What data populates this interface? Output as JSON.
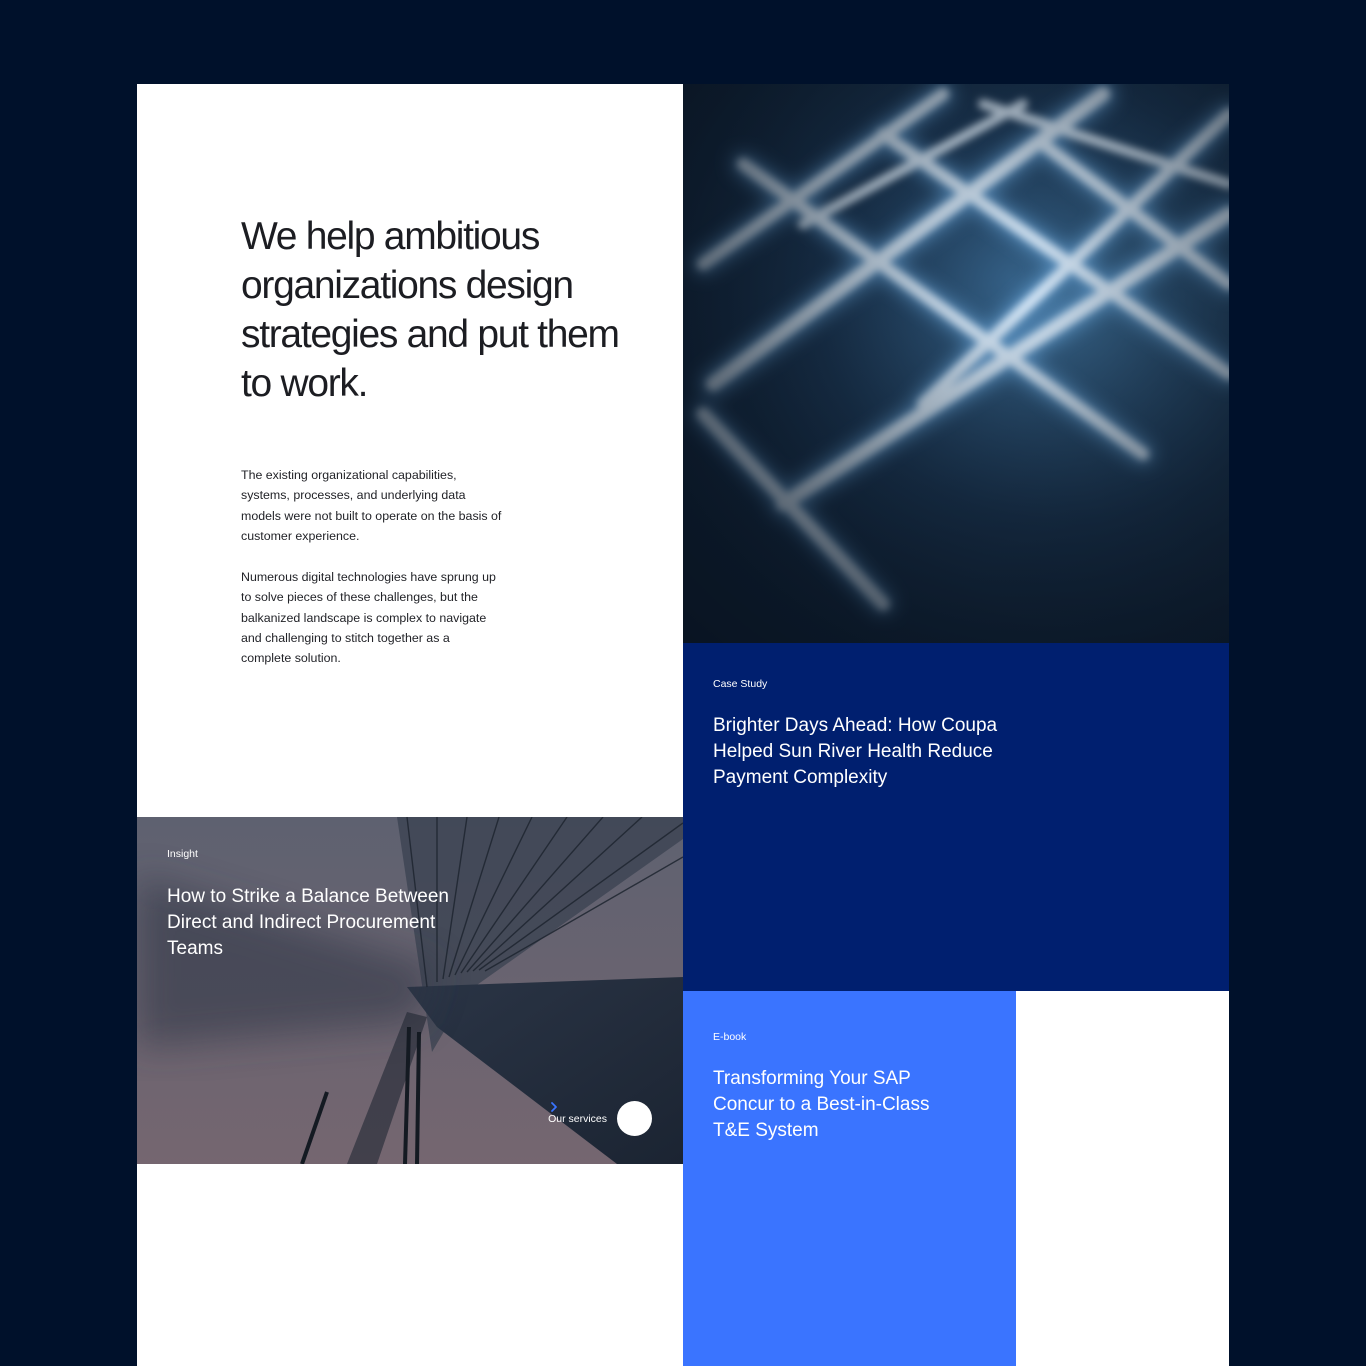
{
  "intro": {
    "headline": "We help ambitious organizations design strategies and put them to work.",
    "paragraph_1": "The existing organizational capabilities, systems, processes, and underlying data models were not built to operate on the basis of customer experience.",
    "paragraph_2": "Numerous digital technologies have sprung up to solve pieces of these challenges, but the balkanized landscape is complex to navigate and challenging to stitch together as a complete solution."
  },
  "cards": {
    "case_study": {
      "tag": "Case Study",
      "title": "Brighter Days Ahead: How Coupa Helped Sun River Health Reduce Payment Complexity"
    },
    "insight": {
      "tag": "Insight",
      "title": "How to Strike a Balance Between Direct and Indirect Procurement Teams",
      "cta_label": "Our services",
      "cta_icon": "chevron-right-icon"
    },
    "ebook": {
      "tag": "E-book",
      "title": "Transforming Your SAP Concur to a Best-in-Class T&E System"
    }
  },
  "colors": {
    "page_background": "#00112b",
    "case_study_background": "#001f6f",
    "ebook_background": "#3a74ff",
    "card_text": "#ffffff",
    "chevron": "#3a74ff"
  },
  "images": {
    "hero": "blurred glowing blue light-stick lattice",
    "insight": "looking up at architectural building facade"
  }
}
